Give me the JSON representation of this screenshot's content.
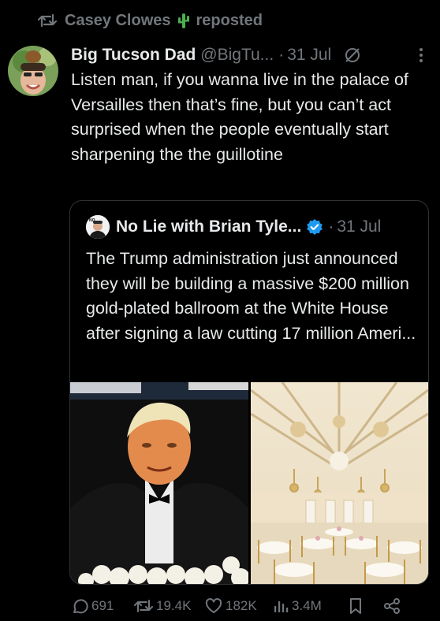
{
  "repost": {
    "user": "Casey Clowes",
    "label": "reposted",
    "cactus": "🌵"
  },
  "post": {
    "author_name": "Big Tucson Dad",
    "handle": "@BigTu...",
    "separator": "·",
    "date": "31 Jul",
    "text": "Listen man, if you wanna live in the palace of Versailles then that’s fine, but you can’t act surprised when the people eventually start sharpening the the guillotine"
  },
  "quote": {
    "author_name": "No Lie with Brian Tyle...",
    "separator": "·",
    "date": "31 Jul",
    "text": "The Trump administration just announced they will be building a massive $200 million gold-plated ballroom at the White House after signing a law cutting 17 million Ameri...",
    "verified_color": "#1d9bf0"
  },
  "actions": {
    "replies": "691",
    "reposts": "19.4K",
    "likes": "182K",
    "views": "3.4M"
  },
  "icons": [
    "repost-icon",
    "grok-icon",
    "more-icon",
    "verified-icon",
    "reply-icon",
    "like-icon",
    "views-icon",
    "bookmark-icon",
    "share-icon"
  ]
}
